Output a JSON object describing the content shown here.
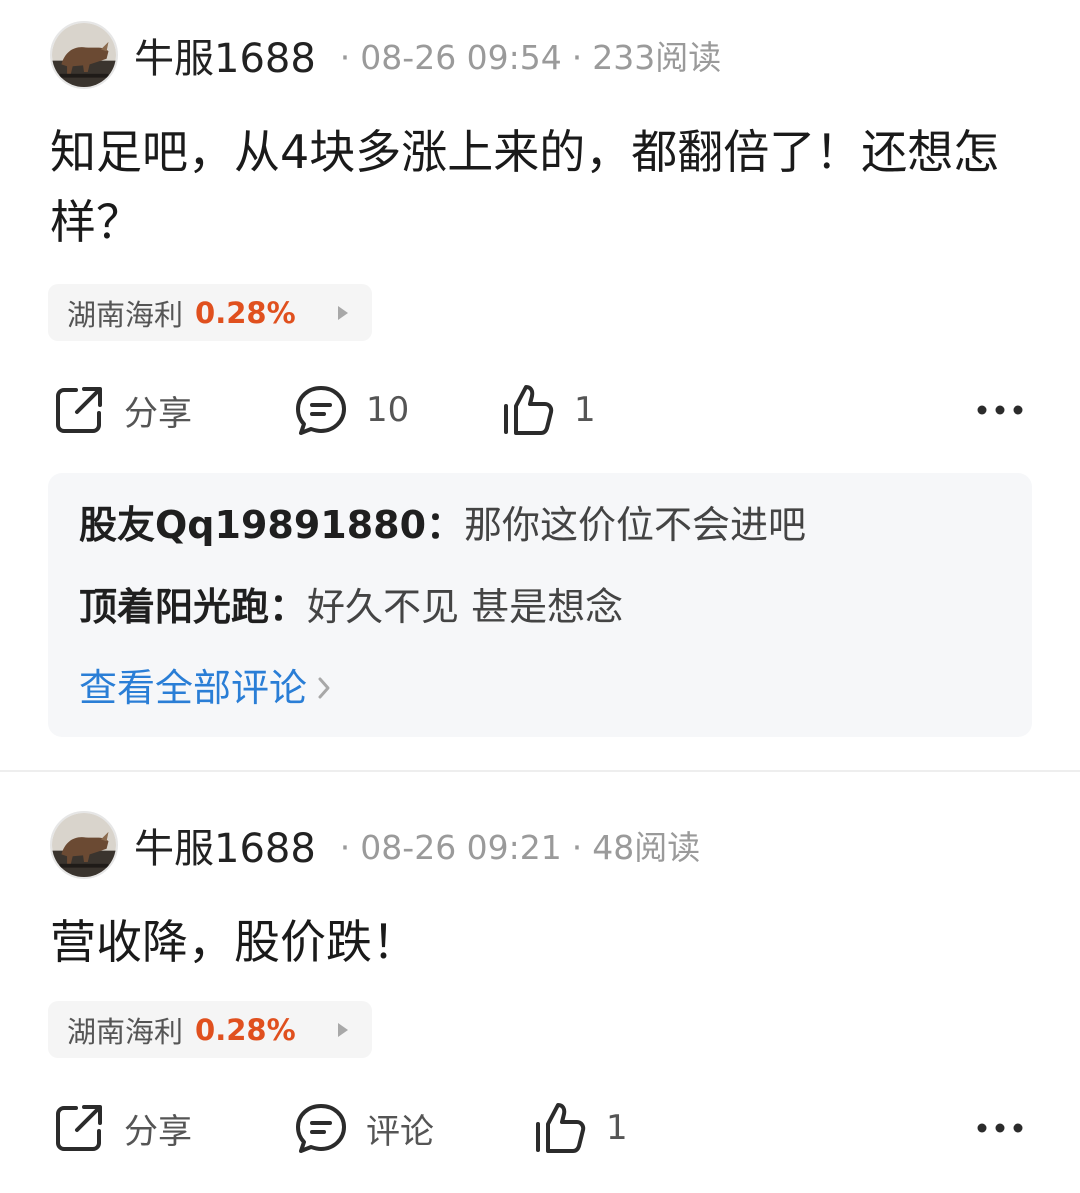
{
  "posts": [
    {
      "author": "牛服1688",
      "time": "08-26 09:54",
      "reads": "233阅读",
      "content": "知足吧，从4块多涨上来的，都翻倍了！还想怎样？",
      "stock": {
        "name": "湖南海利",
        "change": "0.28%"
      },
      "actions": {
        "share": "分享",
        "comment": "10",
        "like": "1"
      },
      "comments": [
        {
          "user": "股友Qq19891880",
          "text": "那你这价位不会进吧"
        },
        {
          "user": "顶着阳光跑",
          "text": "好久不见 甚是想念"
        }
      ],
      "view_all": "查看全部评论"
    },
    {
      "author": "牛服1688",
      "time": "08-26 09:21",
      "reads": "48阅读",
      "content": "营收降，股价跌！",
      "stock": {
        "name": "湖南海利",
        "change": "0.28%"
      },
      "actions": {
        "share": "分享",
        "comment": "评论",
        "like": "1"
      }
    }
  ],
  "colors": {
    "stock_up": "#e0501e",
    "link": "#2a7ed6",
    "meta": "#9a9a9a",
    "tag_bg": "#f5f5f5",
    "comment_bg": "#f6f7f9"
  },
  "icons": {
    "share": "share-icon",
    "comment": "comment-icon",
    "like": "thumbs-up-icon",
    "more": "more-dots-icon",
    "stock_arrow": "triangle-right-icon",
    "view_all_arrow": "chevron-right-icon"
  }
}
